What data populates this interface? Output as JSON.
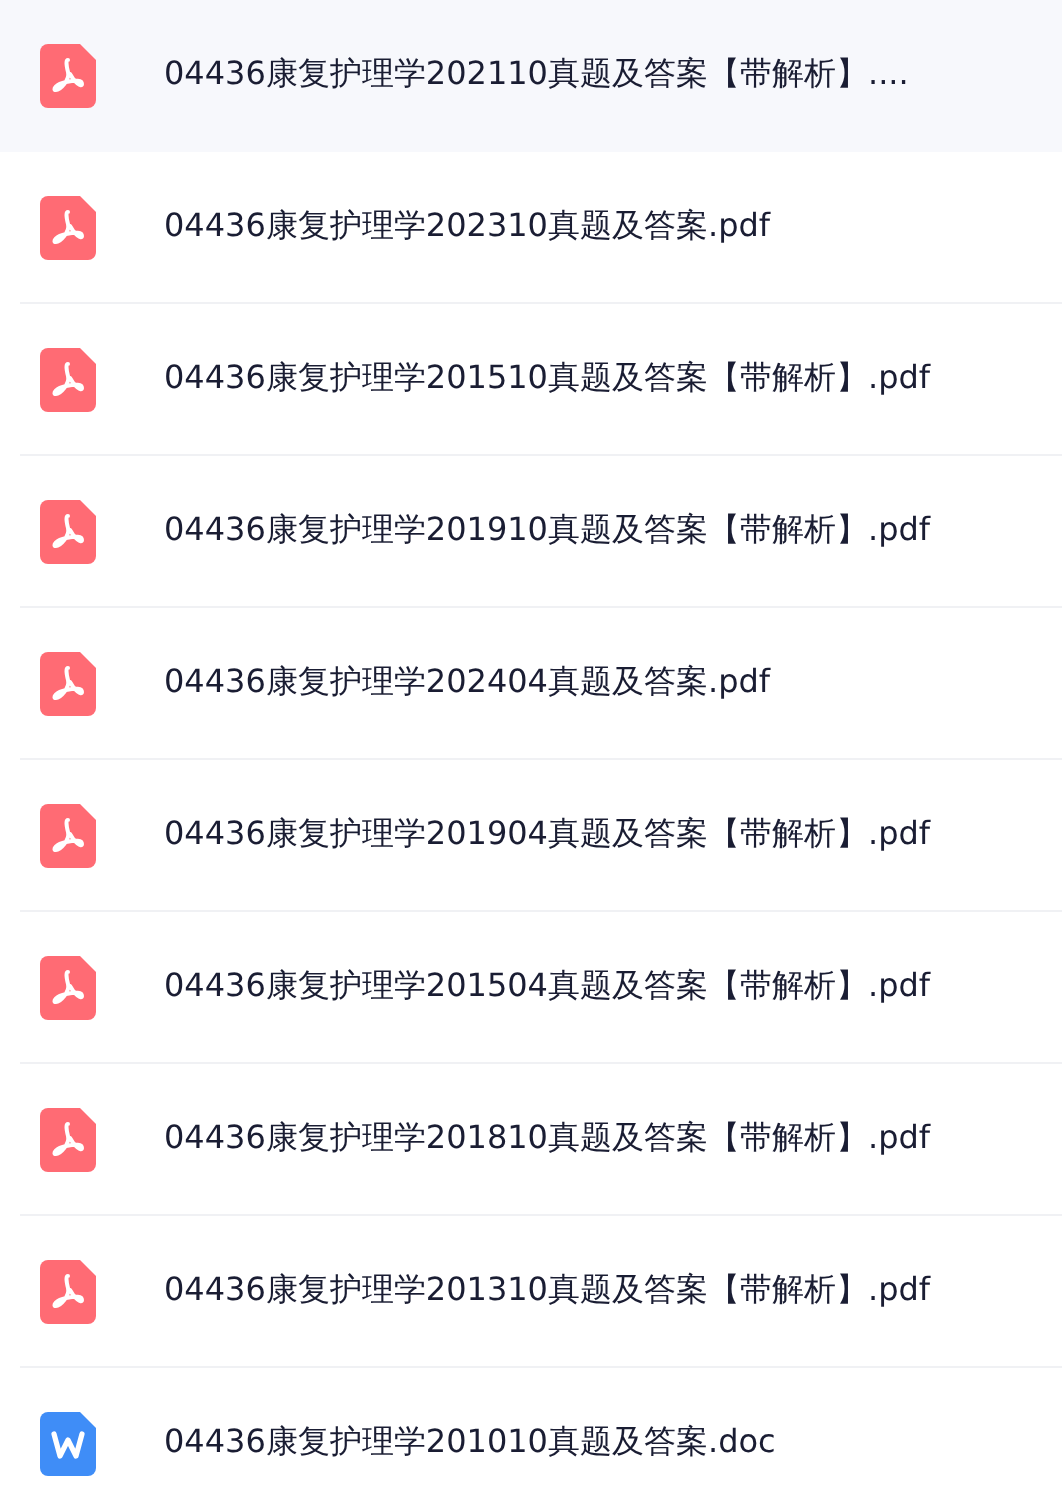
{
  "files": [
    {
      "name": "04436康复护理学202110真题及答案【带解析】....",
      "kind": "pdf",
      "selected": true
    },
    {
      "name": "04436康复护理学202310真题及答案.pdf",
      "kind": "pdf",
      "selected": false
    },
    {
      "name": "04436康复护理学201510真题及答案【带解析】.pdf",
      "kind": "pdf",
      "selected": false
    },
    {
      "name": "04436康复护理学201910真题及答案【带解析】.pdf",
      "kind": "pdf",
      "selected": false
    },
    {
      "name": "04436康复护理学202404真题及答案.pdf",
      "kind": "pdf",
      "selected": false
    },
    {
      "name": "04436康复护理学201904真题及答案【带解析】.pdf",
      "kind": "pdf",
      "selected": false
    },
    {
      "name": "04436康复护理学201504真题及答案【带解析】.pdf",
      "kind": "pdf",
      "selected": false
    },
    {
      "name": "04436康复护理学201810真题及答案【带解析】.pdf",
      "kind": "pdf",
      "selected": false
    },
    {
      "name": "04436康复护理学201310真题及答案【带解析】.pdf",
      "kind": "pdf",
      "selected": false
    },
    {
      "name": "04436康复护理学201010真题及答案.doc",
      "kind": "doc",
      "selected": false
    }
  ]
}
